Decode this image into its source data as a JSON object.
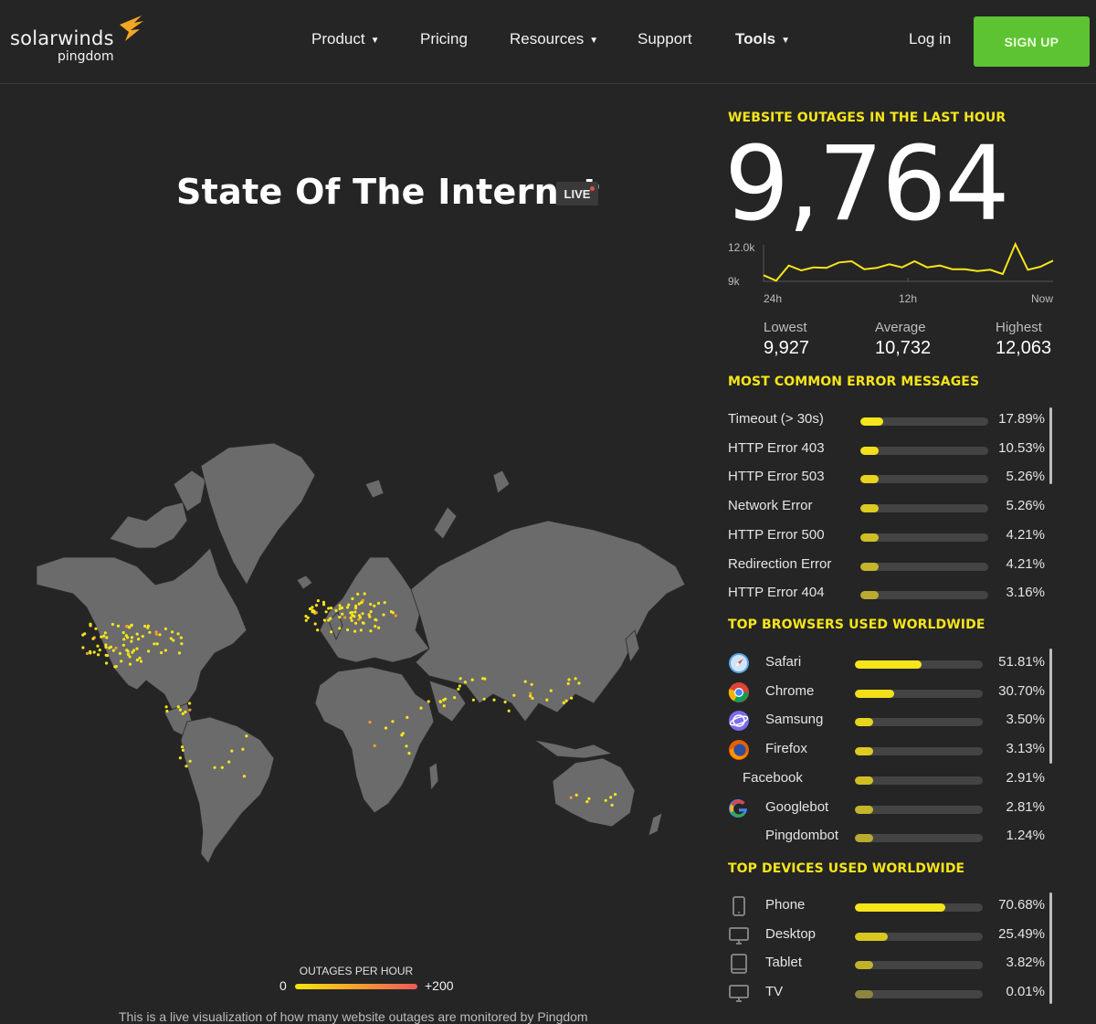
{
  "header": {
    "logo_main": "solarwinds",
    "logo_sub": "pingdom",
    "nav": [
      {
        "label": "Product",
        "has_dropdown": true
      },
      {
        "label": "Pricing",
        "has_dropdown": false
      },
      {
        "label": "Resources",
        "has_dropdown": true
      },
      {
        "label": "Support",
        "has_dropdown": false
      },
      {
        "label": "Tools",
        "has_dropdown": true
      }
    ],
    "login_label": "Log in",
    "signup_label": "SIGN UP",
    "chevron": "⌄"
  },
  "main": {
    "title": "State Of The Internet",
    "live_badge": "LIVE",
    "legend": {
      "title": "OUTAGES PER HOUR",
      "min": "0",
      "max": "+200"
    },
    "footnote": "This is a live visualization of how many website outages are monitored by Pingdom"
  },
  "outages": {
    "title": "WEBSITE OUTAGES IN THE LAST HOUR",
    "value": "9,764",
    "chart": {
      "y_labels": [
        "12.0k",
        "9k"
      ],
      "x_labels": [
        "24h",
        "12h",
        "Now"
      ],
      "values": [
        9500,
        9050,
        10300,
        9900,
        10150,
        10100,
        10550,
        10650,
        10000,
        10100,
        10400,
        10150,
        10650,
        10150,
        10300,
        10000,
        10000,
        9850,
        9950,
        9600,
        12063,
        9950,
        10200,
        10700
      ]
    },
    "stats": [
      {
        "label": "Lowest",
        "value": "9,927"
      },
      {
        "label": "Average",
        "value": "10,732"
      },
      {
        "label": "Highest",
        "value": "12,063"
      }
    ]
  },
  "errors": {
    "title": "MOST COMMON ERROR MESSAGES",
    "items": [
      {
        "label": "Timeout (> 30s)",
        "pct": "17.89%",
        "value": 17.89
      },
      {
        "label": "HTTP Error 403",
        "pct": "10.53%",
        "value": 10.53
      },
      {
        "label": "HTTP Error 503",
        "pct": "5.26%",
        "value": 5.26
      },
      {
        "label": "Network Error",
        "pct": "5.26%",
        "value": 5.26
      },
      {
        "label": "HTTP Error 500",
        "pct": "4.21%",
        "value": 4.21
      },
      {
        "label": "Redirection Error",
        "pct": "4.21%",
        "value": 4.21
      },
      {
        "label": "HTTP Error 404",
        "pct": "3.16%",
        "value": 3.16
      }
    ]
  },
  "browsers": {
    "title": "TOP BROWSERS USED WORLDWIDE",
    "items": [
      {
        "label": "Safari",
        "pct": "51.81%",
        "value": 51.81,
        "icon": "safari-icon"
      },
      {
        "label": "Chrome",
        "pct": "30.70%",
        "value": 30.7,
        "icon": "chrome-icon"
      },
      {
        "label": "Samsung",
        "pct": "3.50%",
        "value": 3.5,
        "icon": "samsung-internet-icon"
      },
      {
        "label": "Firefox",
        "pct": "3.13%",
        "value": 3.13,
        "icon": "firefox-icon"
      },
      {
        "label": "Facebook",
        "pct": "2.91%",
        "value": 2.91,
        "icon": ""
      },
      {
        "label": "Googlebot",
        "pct": "2.81%",
        "value": 2.81,
        "icon": "google-icon"
      },
      {
        "label": "Pingdombot",
        "pct": "1.24%",
        "value": 1.24,
        "icon": ""
      }
    ]
  },
  "devices": {
    "title": "TOP DEVICES USED WORLDWIDE",
    "items": [
      {
        "label": "Phone",
        "pct": "70.68%",
        "value": 70.68,
        "icon": "phone-icon"
      },
      {
        "label": "Desktop",
        "pct": "25.49%",
        "value": 25.49,
        "icon": "desktop-icon"
      },
      {
        "label": "Tablet",
        "pct": "3.82%",
        "value": 3.82,
        "icon": "tablet-icon"
      },
      {
        "label": "TV",
        "pct": "0.01%",
        "value": 0.01,
        "icon": "tv-icon"
      }
    ]
  },
  "colors": {
    "accent_yellow": "#f6e51a",
    "signup_green": "#5ec332",
    "background": "#252525",
    "land": "#6b6b6b",
    "bar_track": "#444444"
  }
}
